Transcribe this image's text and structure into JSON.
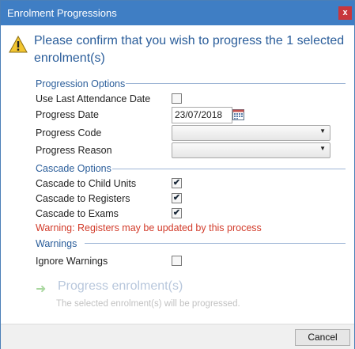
{
  "window": {
    "title": "Enrolment Progressions",
    "close_label": "x"
  },
  "header": {
    "message": "Please confirm that you wish to progress the 1 selected enrolment(s)",
    "icon": "warning-icon"
  },
  "progression_options": {
    "title": "Progression Options",
    "use_last_attendance_label": "Use Last Attendance Date",
    "use_last_attendance_checked": false,
    "progress_date_label": "Progress Date",
    "progress_date_value": "23/07/2018",
    "progress_code_label": "Progress Code",
    "progress_code_value": "",
    "progress_reason_label": "Progress Reason",
    "progress_reason_value": ""
  },
  "cascade_options": {
    "title": "Cascade Options",
    "child_units_label": "Cascade to Child Units",
    "child_units_checked": true,
    "registers_label": "Cascade to Registers",
    "registers_checked": true,
    "exams_label": "Cascade to Exams",
    "exams_checked": true,
    "warning_text": "Warning: Registers may be updated by this process"
  },
  "warnings": {
    "title": "Warnings",
    "ignore_label": "Ignore Warnings",
    "ignore_checked": false
  },
  "action": {
    "label": "Progress enrolment(s)",
    "description": "The selected enrolment(s) will be progressed.",
    "icon": "arrow-right-icon"
  },
  "footer": {
    "cancel_label": "Cancel"
  },
  "colors": {
    "titlebar": "#3f7ec4",
    "heading": "#2a5d9a",
    "warning": "#d23b2a",
    "close": "#c8363c"
  }
}
